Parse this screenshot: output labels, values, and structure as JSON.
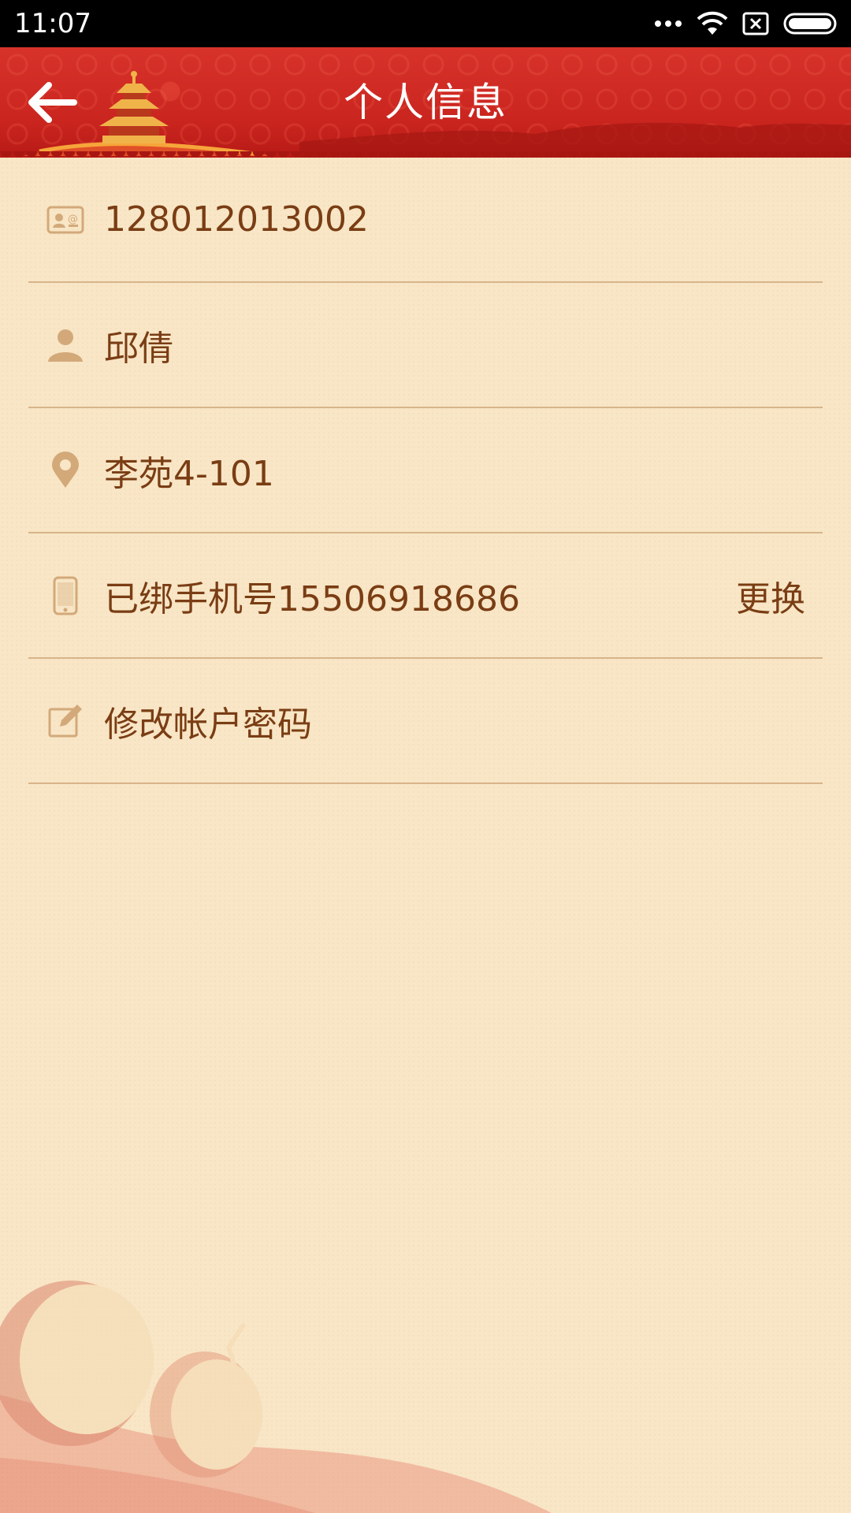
{
  "status_bar": {
    "time": "11:07"
  },
  "header": {
    "title": "个人信息",
    "back_icon": "arrow-left-icon"
  },
  "info_rows": [
    {
      "icon": "id-card-icon",
      "text": "128012013002"
    },
    {
      "icon": "person-icon",
      "text": "邱倩"
    },
    {
      "icon": "location-pin-icon",
      "text": "李苑4-101"
    },
    {
      "icon": "phone-icon",
      "text": "已绑手机号15506918686",
      "action": "更换"
    },
    {
      "icon": "edit-icon",
      "text": "修改帐户密码"
    }
  ],
  "colors": {
    "background": "#f8e6c6",
    "header_red": "#c9241e",
    "text_brown": "#7a3d14",
    "icon_tan": "#d3a97a",
    "divider": "#d8b48a"
  }
}
